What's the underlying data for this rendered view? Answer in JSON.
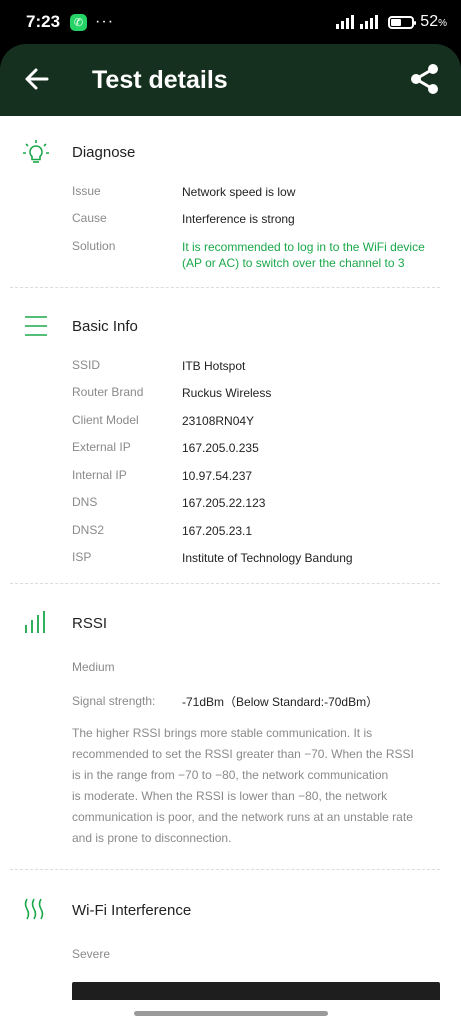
{
  "status_bar": {
    "time": "7:23",
    "dots": "···",
    "battery": "52",
    "battery_unit": "%"
  },
  "header": {
    "title": "Test details"
  },
  "diagnose": {
    "title": "Diagnose",
    "rows": [
      {
        "label": "Issue",
        "value": "Network speed is low"
      },
      {
        "label": "Cause",
        "value": "Interference is strong"
      },
      {
        "label": "Solution",
        "value_line1": "It is recommended to log in to the WiFi device",
        "value_line2": "(AP or AC) to switch over the channel to 3"
      }
    ]
  },
  "basic_info": {
    "title": "Basic Info",
    "rows": [
      {
        "label": "SSID",
        "value": "ITB Hotspot"
      },
      {
        "label": "Router Brand",
        "value": "Ruckus Wireless"
      },
      {
        "label": "Client Model",
        "value": "23108RN04Y"
      },
      {
        "label": "External IP",
        "value": "167.205.0.235"
      },
      {
        "label": "Internal IP",
        "value": "10.97.54.237"
      },
      {
        "label": "DNS",
        "value": "167.205.22.123"
      },
      {
        "label": "DNS2",
        "value": "167.205.23.1"
      },
      {
        "label": "ISP",
        "value": "Institute of Technology Bandung"
      }
    ]
  },
  "rssi": {
    "title": "RSSI",
    "level": "Medium",
    "signal_label": "Signal strength:",
    "signal_value": "-71dBm（Below Standard:-70dBm）",
    "description": [
      "The higher RSSI brings more stable communication. It is",
      "recommended to set the RSSI greater than −70. When the RSSI",
      "is in the range from −70 to −80, the network communication",
      "is moderate. When the RSSI is lower than −80, the network",
      "communication is poor, and the network runs at an unstable rate",
      "and is prone to disconnection."
    ]
  },
  "wifi_interference": {
    "title": "Wi-Fi Interference",
    "level": "Severe"
  },
  "colors": {
    "header_bg": "#16301f",
    "accent_green": "#1aa84a"
  }
}
